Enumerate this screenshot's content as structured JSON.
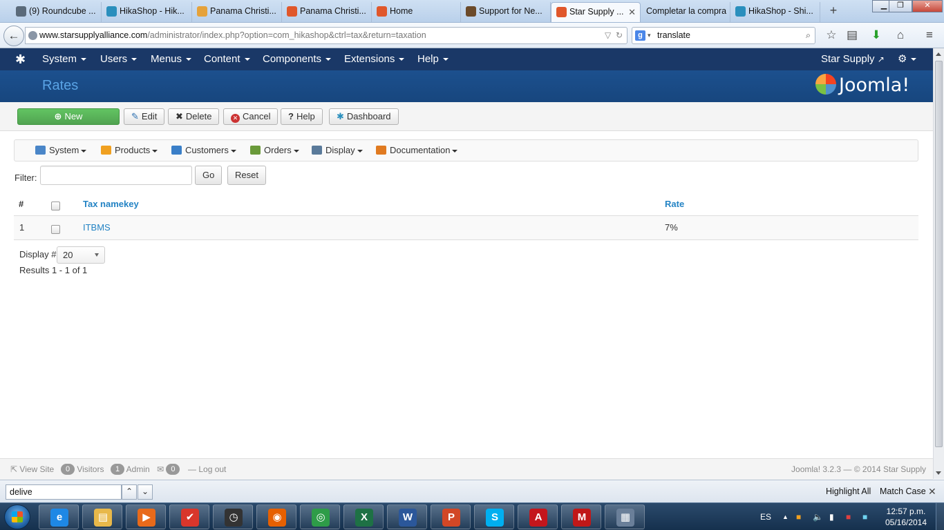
{
  "browser": {
    "tabs": [
      {
        "label": "(9) Roundcube ...",
        "icon": "roundcube-icon",
        "color": "#5a6a7a",
        "active": false
      },
      {
        "label": "HikaShop - Hik...",
        "icon": "hikashop-icon",
        "color": "#2a8fbd",
        "active": false
      },
      {
        "label": "Panama Christi...",
        "icon": "panama-icon",
        "color": "#e5a23a",
        "active": false
      },
      {
        "label": "Panama Christi...",
        "icon": "joomla-icon",
        "color": "#e0572b",
        "active": false
      },
      {
        "label": "Home",
        "icon": "joomla-icon",
        "color": "#e0572b",
        "active": false
      },
      {
        "label": "Support for Ne...",
        "icon": "support-icon",
        "color": "#6b4a2a",
        "active": false
      },
      {
        "label": "Star Supply ...",
        "icon": "joomla-icon",
        "color": "#e0572b",
        "active": true
      },
      {
        "label": "Completar la compra",
        "icon": "",
        "color": "",
        "active": false
      },
      {
        "label": "HikaShop - Shi...",
        "icon": "hikashop-icon",
        "color": "#2a8fbd",
        "active": false
      }
    ],
    "url": {
      "domain": "www.starsupplyalliance.com",
      "path": "/administrator/index.php?option=com_hikashop&ctrl=tax&return=taxation"
    },
    "search": {
      "value": "translate"
    }
  },
  "joomla": {
    "menu": [
      "System",
      "Users",
      "Menus",
      "Content",
      "Components",
      "Extensions",
      "Help"
    ],
    "site_link": "Star Supply",
    "page_title": "Rates",
    "brand": "Joomla!"
  },
  "toolbar": {
    "new_label": "New",
    "edit_label": "Edit",
    "delete_label": "Delete",
    "cancel_label": "Cancel",
    "help_label": "Help",
    "dashboard_label": "Dashboard"
  },
  "hikamenu": [
    {
      "label": "System",
      "icon": "tools-icon",
      "color": "#4a86c8"
    },
    {
      "label": "Products",
      "icon": "box-icon",
      "color": "#f0a020"
    },
    {
      "label": "Customers",
      "icon": "users-icon",
      "color": "#3a7fc8"
    },
    {
      "label": "Orders",
      "icon": "orders-icon",
      "color": "#6a9a3a"
    },
    {
      "label": "Display",
      "icon": "display-icon",
      "color": "#5a7a9a"
    },
    {
      "label": "Documentation",
      "icon": "docs-icon",
      "color": "#e07a20"
    }
  ],
  "filter": {
    "label": "Filter:",
    "value": "",
    "go_label": "Go",
    "reset_label": "Reset"
  },
  "table": {
    "headers": {
      "num": "#",
      "namekey": "Tax namekey",
      "rate": "Rate"
    },
    "rows": [
      {
        "num": "1",
        "namekey": "ITBMS",
        "rate": "7%"
      }
    ]
  },
  "pagination": {
    "display_label": "Display #",
    "display_value": "20",
    "results": "Results 1 - 1 of 1"
  },
  "statusbar": {
    "view_site": "View Site",
    "visitors_count": "0",
    "visitors_label": "Visitors",
    "admin_count": "1",
    "admin_label": "Admin",
    "messages_count": "0",
    "logout_label": "Log out",
    "copyright": "Joomla! 3.2.3 — © 2014 Star Supply"
  },
  "findbar": {
    "value": "delive",
    "highlight_label": "Highlight All",
    "matchcase_label": "Match Case"
  },
  "taskbar": {
    "apps": [
      {
        "name": "ie-icon",
        "glyph": "e",
        "color": "#1e88e5"
      },
      {
        "name": "explorer-icon",
        "glyph": "▤",
        "color": "#e8b84a"
      },
      {
        "name": "media-player-icon",
        "glyph": "▶",
        "color": "#e86a1a"
      },
      {
        "name": "todoist-icon",
        "glyph": "✔",
        "color": "#d9362b"
      },
      {
        "name": "clock-icon",
        "glyph": "◷",
        "color": "#333333"
      },
      {
        "name": "firefox-icon",
        "glyph": "◉",
        "color": "#e66000"
      },
      {
        "name": "chrome-icon",
        "glyph": "◎",
        "color": "#2e9c48"
      },
      {
        "name": "excel-icon",
        "glyph": "X",
        "color": "#1e7145"
      },
      {
        "name": "word-icon",
        "glyph": "W",
        "color": "#2b579a"
      },
      {
        "name": "powerpoint-icon",
        "glyph": "P",
        "color": "#d24726"
      },
      {
        "name": "skype-icon",
        "glyph": "S",
        "color": "#00aff0"
      },
      {
        "name": "acrobat-icon",
        "glyph": "A",
        "color": "#c4161c"
      },
      {
        "name": "mcafee-icon",
        "glyph": "M",
        "color": "#c01818"
      },
      {
        "name": "calculator-icon",
        "glyph": "▦",
        "color": "#6a7f99"
      }
    ],
    "language": "ES",
    "time": "12:57 p.m.",
    "date": "05/16/2014"
  }
}
